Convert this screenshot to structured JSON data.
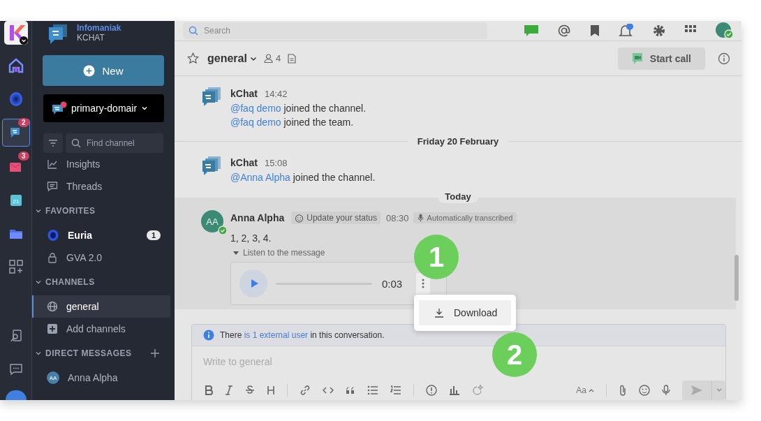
{
  "rail": {
    "items": [
      {
        "kind": "home",
        "selected": false
      },
      {
        "kind": "ai",
        "selected": false
      },
      {
        "kind": "chat",
        "selected": true,
        "badge": "2"
      },
      {
        "kind": "mail",
        "selected": false,
        "badge": "3"
      },
      {
        "kind": "calendar",
        "selected": false,
        "calendar_day": "21"
      },
      {
        "kind": "drive",
        "selected": false
      },
      {
        "kind": "apps",
        "selected": false
      }
    ],
    "bottom_items": [
      {
        "kind": "contacts",
        "selected": false
      },
      {
        "kind": "feedback",
        "selected": false
      }
    ]
  },
  "workspace": {
    "name": "Infomaniak",
    "product": "KCHAT"
  },
  "new_button": {
    "label": "New"
  },
  "team_switcher": {
    "label": "primary-domair",
    "unread": true
  },
  "find_channel": {
    "placeholder": "Find channel"
  },
  "sidebar_links": [
    {
      "kind": "insights",
      "label": "Insights"
    },
    {
      "kind": "threads",
      "label": "Threads"
    }
  ],
  "sections": [
    {
      "title": "FAVORITES",
      "expanded": true,
      "can_add": false,
      "items": [
        {
          "kind": "ai",
          "label": "Euria",
          "unread": true,
          "badge": "1",
          "selected": false
        },
        {
          "kind": "private",
          "label": "GVA 2.0",
          "unread": false,
          "selected": false
        }
      ]
    },
    {
      "title": "CHANNELS",
      "expanded": true,
      "can_add": false,
      "items": [
        {
          "kind": "public",
          "label": "general",
          "unread": true,
          "selected": true
        },
        {
          "kind": "add",
          "label": "Add channels",
          "unread": false,
          "selected": false
        }
      ]
    },
    {
      "title": "DIRECT MESSAGES",
      "expanded": true,
      "can_add": true,
      "items": [
        {
          "kind": "user",
          "label": "Anna Alpha",
          "initials": "AA",
          "unread": false,
          "selected": false
        }
      ]
    }
  ],
  "topbar": {
    "search": {
      "placeholder": "Search"
    }
  },
  "channel_header": {
    "name": "general",
    "favorite": false,
    "members": "4",
    "call_button": "Start call"
  },
  "messages": [
    {
      "kind": "bot",
      "author": "kChat",
      "time": "14:42",
      "highlighted": false,
      "lines": [
        {
          "mention": "@faq demo",
          "text": " joined the channel."
        },
        {
          "mention": "@faq demo",
          "text": " joined the team."
        }
      ]
    },
    {
      "kind": "date",
      "label": "Friday 20 February",
      "pill": false
    },
    {
      "kind": "bot",
      "author": "kChat",
      "time": "15:08",
      "highlighted": false,
      "lines": [
        {
          "mention": "@Anna Alpha",
          "text": " joined the channel."
        }
      ]
    },
    {
      "kind": "date",
      "label": "Today",
      "pill": true
    },
    {
      "kind": "user",
      "author": "Anna Alpha",
      "initials": "AA",
      "online": true,
      "highlighted": true,
      "status_button": "Update your status",
      "time": "08:30",
      "tag": "Automatically transcribed",
      "body": "1, 2, 3, 4.",
      "transcript": {
        "label": "Listen to the message",
        "expanded": true
      },
      "audio": {
        "duration": "0:03",
        "level": 0,
        "menu_open": true,
        "menu": [
          {
            "label": "Download"
          }
        ]
      }
    }
  ],
  "composer": {
    "banner": {
      "before": "There ",
      "link": "is 1 external user",
      "after": " in this conversation."
    },
    "placeholder": "Write to general",
    "font_button": "Aa"
  },
  "callouts": [
    {
      "label": "1"
    },
    {
      "label": "2"
    }
  ]
}
